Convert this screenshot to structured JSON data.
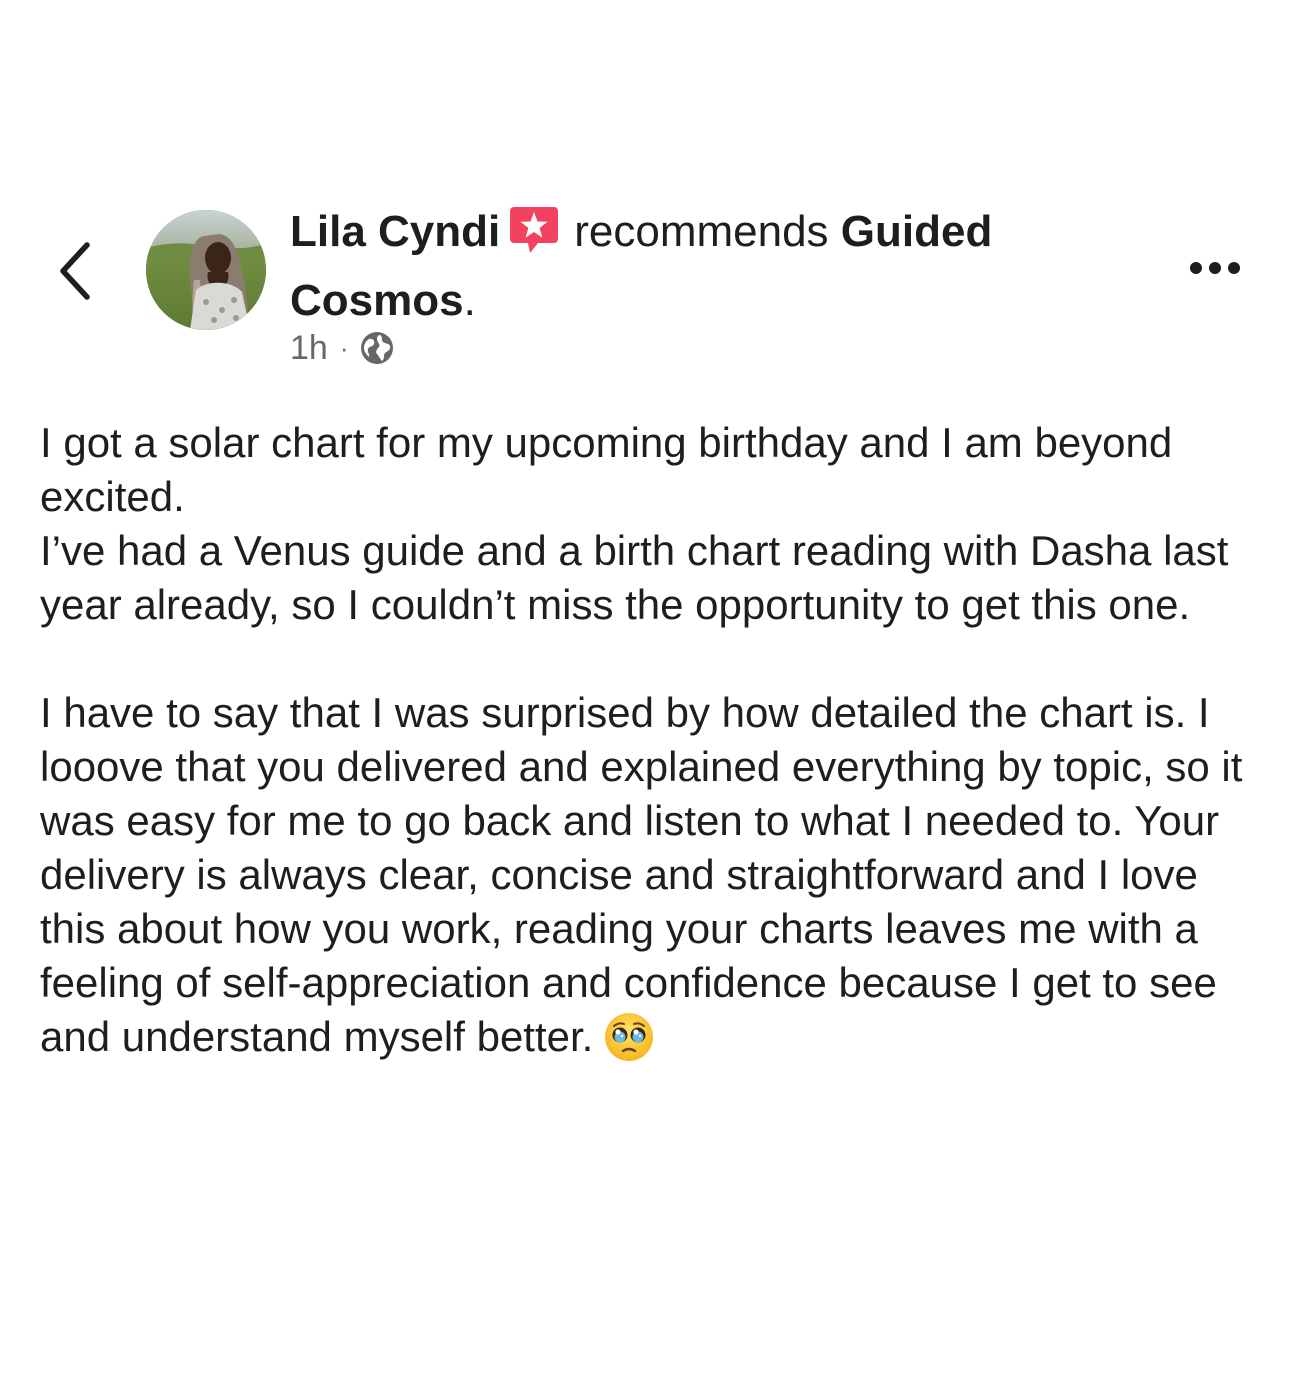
{
  "post": {
    "author": "Lila Cyndi",
    "action": "recommends",
    "page": "Guided Cosmos",
    "page_suffix": ".",
    "time": "1h",
    "separator": "·",
    "privacy_icon": "globe-icon",
    "badge_icon": "recommendation-star-icon",
    "badge_color": "#f3425f",
    "paragraphs": [
      "I got a solar chart for my upcoming birthday and I am beyond excited.",
      "I’ve had a Venus guide and a birth chart reading with Dasha last year already, so I couldn’t miss the opportunity to get this one.",
      "I have to say that I was surprised by how detailed the chart is. I looove that you delivered and explained everything by topic, so it was easy for me to go back and listen to what I needed to. Your delivery is always clear, concise and straightforward and I love this about how you work, reading your charts leaves me with a feeling of self-appreciation and confidence because I get to see and understand myself better."
    ],
    "end_emoji": "pleading-face-emoji"
  },
  "nav": {
    "back_icon": "chevron-left-icon",
    "more_icon": "more-horizontal-icon"
  }
}
